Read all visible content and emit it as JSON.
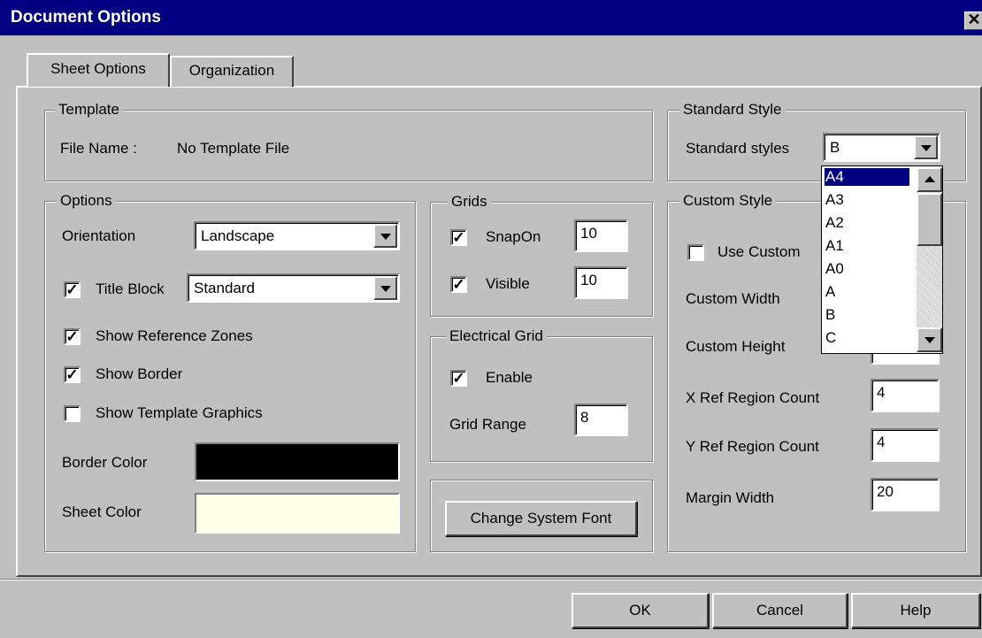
{
  "window": {
    "title": "Document Options",
    "close_glyph": "✕"
  },
  "tabs": [
    {
      "label": "Sheet Options",
      "active": true
    },
    {
      "label": "Organization",
      "active": false
    }
  ],
  "template": {
    "group_label": "Template",
    "file_name_label": "File Name :",
    "file_name_value": "No Template File"
  },
  "standard_style": {
    "group_label": "Standard Style",
    "label": "Standard styles",
    "value": "B",
    "dropdown_items": [
      "A4",
      "A3",
      "A2",
      "A1",
      "A0",
      "A",
      "B",
      "C"
    ],
    "highlighted": "A4"
  },
  "options": {
    "group_label": "Options",
    "orientation_label": "Orientation",
    "orientation_value": "Landscape",
    "title_block_label": "Title Block",
    "title_block_checked": true,
    "title_block_value": "Standard",
    "show_reference_zones_label": "Show Reference Zones",
    "show_reference_zones_checked": true,
    "show_border_label": "Show Border",
    "show_border_checked": true,
    "show_template_graphics_label": "Show Template Graphics",
    "show_template_graphics_checked": false,
    "border_color_label": "Border Color",
    "border_color": "#000000",
    "sheet_color_label": "Sheet Color",
    "sheet_color": "#ffffe6"
  },
  "grids": {
    "group_label": "Grids",
    "snapon_label": "SnapOn",
    "snapon_checked": true,
    "snapon_value": "10",
    "visible_label": "Visible",
    "visible_checked": true,
    "visible_value": "10"
  },
  "electrical_grid": {
    "group_label": "Electrical Grid",
    "enable_label": "Enable",
    "enable_checked": true,
    "grid_range_label": "Grid Range",
    "grid_range_value": "8"
  },
  "change_font_label": "Change System Font",
  "custom_style": {
    "group_label": "Custom Style",
    "use_custom_label": "Use Custom",
    "use_custom_checked": false,
    "custom_width_label": "Custom Width",
    "custom_height_label": "Custom Height",
    "x_ref_label": "X Ref Region Count",
    "x_ref_value": "4",
    "y_ref_label": "Y Ref Region Count",
    "y_ref_value": "4",
    "margin_width_label": "Margin Width",
    "margin_width_value": "20"
  },
  "buttons": {
    "ok": "OK",
    "cancel": "Cancel",
    "help": "Help"
  },
  "checkmark": "✓"
}
